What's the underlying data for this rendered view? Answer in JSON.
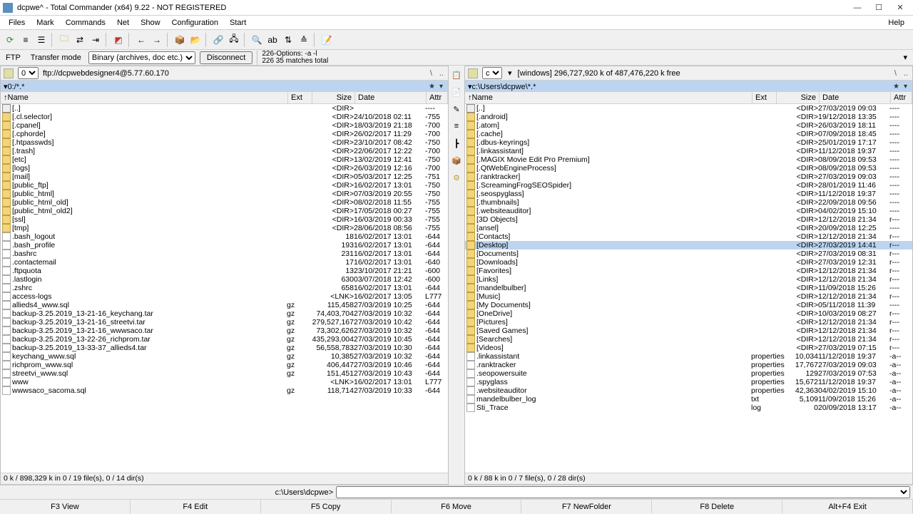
{
  "window": {
    "title": "dcpwe^ - Total Commander (x64) 9.22 - NOT REGISTERED",
    "min": "—",
    "max": "☐",
    "close": "✕"
  },
  "menu": {
    "items": [
      "Files",
      "Mark",
      "Commands",
      "Net",
      "Show",
      "Configuration",
      "Start"
    ],
    "help": "Help"
  },
  "ftp": {
    "label": "FTP",
    "transfer_label": "Transfer mode",
    "transfer_value": "Binary (archives, doc etc.)",
    "disconnect": "Disconnect",
    "status1": "226-Options: -a -l",
    "status2": "226 35 matches total"
  },
  "left": {
    "drive": "0",
    "drive_info": "ftp://dcpwebdesigner4@5.77.60.170",
    "path": "▾0:/*.*",
    "status": "0 k / 898,329 k in 0 / 19 file(s), 0 / 14 dir(s)",
    "cols": {
      "name": "↑Name",
      "ext": "Ext",
      "size": "Size",
      "date": "Date",
      "attr": "Attr"
    },
    "rows": [
      {
        "ic": "up",
        "name": "[..]",
        "ext": "",
        "size": "<DIR>",
        "date": "",
        "attr": "----"
      },
      {
        "ic": "fld",
        "name": "[.cl.selector]",
        "ext": "",
        "size": "<DIR>",
        "date": "24/10/2018 02:11",
        "attr": "-755"
      },
      {
        "ic": "fld",
        "name": "[.cpanel]",
        "ext": "",
        "size": "<DIR>",
        "date": "18/03/2019 21:18",
        "attr": "-700"
      },
      {
        "ic": "fld",
        "name": "[.cphorde]",
        "ext": "",
        "size": "<DIR>",
        "date": "26/02/2017 11:29",
        "attr": "-700"
      },
      {
        "ic": "fld",
        "name": "[.htpasswds]",
        "ext": "",
        "size": "<DIR>",
        "date": "23/10/2017 08:42",
        "attr": "-750"
      },
      {
        "ic": "fld",
        "name": "[.trash]",
        "ext": "",
        "size": "<DIR>",
        "date": "22/06/2017 12:22",
        "attr": "-700"
      },
      {
        "ic": "fld",
        "name": "[etc]",
        "ext": "",
        "size": "<DIR>",
        "date": "13/02/2019 12:41",
        "attr": "-750"
      },
      {
        "ic": "fld",
        "name": "[logs]",
        "ext": "",
        "size": "<DIR>",
        "date": "26/03/2019 12:16",
        "attr": "-700"
      },
      {
        "ic": "fld",
        "name": "[mail]",
        "ext": "",
        "size": "<DIR>",
        "date": "05/03/2017 12:25",
        "attr": "-751"
      },
      {
        "ic": "fld",
        "name": "[public_ftp]",
        "ext": "",
        "size": "<DIR>",
        "date": "16/02/2017 13:01",
        "attr": "-750"
      },
      {
        "ic": "fld",
        "name": "[public_html]",
        "ext": "",
        "size": "<DIR>",
        "date": "07/03/2019 20:55",
        "attr": "-750"
      },
      {
        "ic": "fld",
        "name": "[public_html_old]",
        "ext": "",
        "size": "<DIR>",
        "date": "08/02/2018 11:55",
        "attr": "-755"
      },
      {
        "ic": "fld",
        "name": "[public_html_old2]",
        "ext": "",
        "size": "<DIR>",
        "date": "17/05/2018 00:27",
        "attr": "-755"
      },
      {
        "ic": "fld",
        "name": "[ssl]",
        "ext": "",
        "size": "<DIR>",
        "date": "16/03/2019 00:33",
        "attr": "-755"
      },
      {
        "ic": "fld",
        "name": "[tmp]",
        "ext": "",
        "size": "<DIR>",
        "date": "28/06/2018 08:56",
        "attr": "-755"
      },
      {
        "ic": "file",
        "name": ".bash_logout",
        "ext": "",
        "size": "18",
        "date": "16/02/2017 13:01",
        "attr": "-644"
      },
      {
        "ic": "file",
        "name": ".bash_profile",
        "ext": "",
        "size": "193",
        "date": "16/02/2017 13:01",
        "attr": "-644"
      },
      {
        "ic": "file",
        "name": ".bashrc",
        "ext": "",
        "size": "231",
        "date": "16/02/2017 13:01",
        "attr": "-644"
      },
      {
        "ic": "file",
        "name": ".contactemail",
        "ext": "",
        "size": "17",
        "date": "16/02/2017 13:01",
        "attr": "-640"
      },
      {
        "ic": "file",
        "name": ".ftpquota",
        "ext": "",
        "size": "13",
        "date": "23/10/2017 21:21",
        "attr": "-600"
      },
      {
        "ic": "file",
        "name": ".lastlogin",
        "ext": "",
        "size": "630",
        "date": "03/07/2018 12:42",
        "attr": "-600"
      },
      {
        "ic": "file",
        "name": ".zshrc",
        "ext": "",
        "size": "658",
        "date": "16/02/2017 13:01",
        "attr": "-644"
      },
      {
        "ic": "file",
        "name": "access-logs",
        "ext": "",
        "size": "<LNK>",
        "date": "16/02/2017 13:05",
        "attr": "L777"
      },
      {
        "ic": "file",
        "name": "allieds4_www.sql",
        "ext": "gz",
        "size": "115,458",
        "date": "27/03/2019 10:25",
        "attr": "-644"
      },
      {
        "ic": "file",
        "name": "backup-3.25.2019_13-21-16_keychang.tar",
        "ext": "gz",
        "size": "74,403,704",
        "date": "27/03/2019 10:32",
        "attr": "-644"
      },
      {
        "ic": "file",
        "name": "backup-3.25.2019_13-21-16_streetvi.tar",
        "ext": "gz",
        "size": "279,527,167",
        "date": "27/03/2019 10:42",
        "attr": "-644"
      },
      {
        "ic": "file",
        "name": "backup-3.25.2019_13-21-16_wwwsaco.tar",
        "ext": "gz",
        "size": "73,302,626",
        "date": "27/03/2019 10:32",
        "attr": "-644"
      },
      {
        "ic": "file",
        "name": "backup-3.25.2019_13-22-26_richprom.tar",
        "ext": "gz",
        "size": "435,293,004",
        "date": "27/03/2019 10:45",
        "attr": "-644"
      },
      {
        "ic": "file",
        "name": "backup-3.25.2019_13-33-37_allieds4.tar",
        "ext": "gz",
        "size": "56,558,783",
        "date": "27/03/2019 10:30",
        "attr": "-644"
      },
      {
        "ic": "file",
        "name": "keychang_www.sql",
        "ext": "gz",
        "size": "10,385",
        "date": "27/03/2019 10:32",
        "attr": "-644"
      },
      {
        "ic": "file",
        "name": "richprom_www.sql",
        "ext": "gz",
        "size": "406,447",
        "date": "27/03/2019 10:46",
        "attr": "-644"
      },
      {
        "ic": "file",
        "name": "streetvi_www.sql",
        "ext": "gz",
        "size": "151,451",
        "date": "27/03/2019 10:43",
        "attr": "-644"
      },
      {
        "ic": "file",
        "name": "www",
        "ext": "",
        "size": "<LNK>",
        "date": "16/02/2017 13:01",
        "attr": "L777"
      },
      {
        "ic": "file",
        "name": "wwwsaco_sacoma.sql",
        "ext": "gz",
        "size": "118,714",
        "date": "27/03/2019 10:33",
        "attr": "-644"
      }
    ]
  },
  "right": {
    "drive": "c",
    "drive_info": "[windows]  296,727,920 k of 487,476,220 k free",
    "path": "▾c:\\Users\\dcpwe\\*.*",
    "status": "0 k / 88 k in 0 / 7 file(s), 0 / 28 dir(s)",
    "cols": {
      "name": "↑Name",
      "ext": "Ext",
      "size": "Size",
      "date": "Date",
      "attr": "Attr"
    },
    "rows": [
      {
        "ic": "up",
        "name": "[..]",
        "ext": "",
        "size": "<DIR>",
        "date": "27/03/2019 09:03",
        "attr": "----"
      },
      {
        "ic": "fld",
        "name": "[.android]",
        "ext": "",
        "size": "<DIR>",
        "date": "19/12/2018 13:35",
        "attr": "----"
      },
      {
        "ic": "fld",
        "name": "[.atom]",
        "ext": "",
        "size": "<DIR>",
        "date": "26/03/2019 18:11",
        "attr": "----"
      },
      {
        "ic": "fld",
        "name": "[.cache]",
        "ext": "",
        "size": "<DIR>",
        "date": "07/09/2018 18:45",
        "attr": "----"
      },
      {
        "ic": "fld",
        "name": "[.dbus-keyrings]",
        "ext": "",
        "size": "<DIR>",
        "date": "25/01/2019 17:17",
        "attr": "----"
      },
      {
        "ic": "fld",
        "name": "[.linkassistant]",
        "ext": "",
        "size": "<DIR>",
        "date": "11/12/2018 19:37",
        "attr": "----"
      },
      {
        "ic": "fld",
        "name": "[.MAGIX Movie Edit Pro Premium]",
        "ext": "",
        "size": "<DIR>",
        "date": "08/09/2018 09:53",
        "attr": "----"
      },
      {
        "ic": "fld",
        "name": "[.QtWebEngineProcess]",
        "ext": "",
        "size": "<DIR>",
        "date": "08/09/2018 09:53",
        "attr": "----"
      },
      {
        "ic": "fld",
        "name": "[.ranktracker]",
        "ext": "",
        "size": "<DIR>",
        "date": "27/03/2019 09:03",
        "attr": "----"
      },
      {
        "ic": "fld",
        "name": "[.ScreamingFrogSEOSpider]",
        "ext": "",
        "size": "<DIR>",
        "date": "28/01/2019 11:46",
        "attr": "----"
      },
      {
        "ic": "fld",
        "name": "[.seospyglass]",
        "ext": "",
        "size": "<DIR>",
        "date": "11/12/2018 19:37",
        "attr": "----"
      },
      {
        "ic": "fld",
        "name": "[.thumbnails]",
        "ext": "",
        "size": "<DIR>",
        "date": "22/09/2018 09:56",
        "attr": "----"
      },
      {
        "ic": "fld",
        "name": "[.websiteauditor]",
        "ext": "",
        "size": "<DIR>",
        "date": "04/02/2019 15:10",
        "attr": "----"
      },
      {
        "ic": "fld",
        "name": "[3D Objects]",
        "ext": "",
        "size": "<DIR>",
        "date": "12/12/2018 21:34",
        "attr": "r---"
      },
      {
        "ic": "fld",
        "name": "[ansel]",
        "ext": "",
        "size": "<DIR>",
        "date": "20/09/2018 12:25",
        "attr": "----"
      },
      {
        "ic": "fld",
        "name": "[Contacts]",
        "ext": "",
        "size": "<DIR>",
        "date": "12/12/2018 21:34",
        "attr": "r---"
      },
      {
        "ic": "fld",
        "name": "[Desktop]",
        "ext": "",
        "size": "<DIR>",
        "date": "27/03/2019 14:41",
        "attr": "r---",
        "sel": true
      },
      {
        "ic": "fld",
        "name": "[Documents]",
        "ext": "",
        "size": "<DIR>",
        "date": "27/03/2019 08:31",
        "attr": "r---"
      },
      {
        "ic": "fld",
        "name": "[Downloads]",
        "ext": "",
        "size": "<DIR>",
        "date": "27/03/2019 12:31",
        "attr": "r---"
      },
      {
        "ic": "fld",
        "name": "[Favorites]",
        "ext": "",
        "size": "<DIR>",
        "date": "12/12/2018 21:34",
        "attr": "r---"
      },
      {
        "ic": "fld",
        "name": "[Links]",
        "ext": "",
        "size": "<DIR>",
        "date": "12/12/2018 21:34",
        "attr": "r---"
      },
      {
        "ic": "fld",
        "name": "[mandelbulber]",
        "ext": "",
        "size": "<DIR>",
        "date": "11/09/2018 15:26",
        "attr": "----"
      },
      {
        "ic": "fld",
        "name": "[Music]",
        "ext": "",
        "size": "<DIR>",
        "date": "12/12/2018 21:34",
        "attr": "r---"
      },
      {
        "ic": "fld",
        "name": "[My Documents]",
        "ext": "",
        "size": "<DIR>",
        "date": "05/11/2018 11:39",
        "attr": "----"
      },
      {
        "ic": "fld",
        "name": "[OneDrive]",
        "ext": "",
        "size": "<DIR>",
        "date": "10/03/2019 08:27",
        "attr": "r---"
      },
      {
        "ic": "fld",
        "name": "[Pictures]",
        "ext": "",
        "size": "<DIR>",
        "date": "12/12/2018 21:34",
        "attr": "r---"
      },
      {
        "ic": "fld",
        "name": "[Saved Games]",
        "ext": "",
        "size": "<DIR>",
        "date": "12/12/2018 21:34",
        "attr": "r---"
      },
      {
        "ic": "fld",
        "name": "[Searches]",
        "ext": "",
        "size": "<DIR>",
        "date": "12/12/2018 21:34",
        "attr": "r---"
      },
      {
        "ic": "fld",
        "name": "[Videos]",
        "ext": "",
        "size": "<DIR>",
        "date": "27/03/2019 07:15",
        "attr": "r---"
      },
      {
        "ic": "file",
        "name": ".linkassistant",
        "ext": "properties",
        "size": "10,034",
        "date": "11/12/2018 19:37",
        "attr": "-a--"
      },
      {
        "ic": "file",
        "name": ".ranktracker",
        "ext": "properties",
        "size": "17,767",
        "date": "27/03/2019 09:03",
        "attr": "-a--"
      },
      {
        "ic": "file",
        "name": ".seopowersuite",
        "ext": "properties",
        "size": "129",
        "date": "27/03/2019 07:53",
        "attr": "-a--"
      },
      {
        "ic": "file",
        "name": ".spyglass",
        "ext": "properties",
        "size": "15,672",
        "date": "11/12/2018 19:37",
        "attr": "-a--"
      },
      {
        "ic": "file",
        "name": ".websiteauditor",
        "ext": "properties",
        "size": "42,363",
        "date": "04/02/2019 15:10",
        "attr": "-a--"
      },
      {
        "ic": "file",
        "name": "mandelbulber_log",
        "ext": "txt",
        "size": "5,109",
        "date": "11/09/2018 15:26",
        "attr": "-a--"
      },
      {
        "ic": "file",
        "name": "Sti_Trace",
        "ext": "log",
        "size": "0",
        "date": "20/09/2018 13:17",
        "attr": "-a--"
      }
    ]
  },
  "cmd": {
    "prompt": "c:\\Users\\dcpwe>"
  },
  "fkeys": [
    "F3 View",
    "F4 Edit",
    "F5 Copy",
    "F6 Move",
    "F7 NewFolder",
    "F8 Delete",
    "Alt+F4 Exit"
  ]
}
